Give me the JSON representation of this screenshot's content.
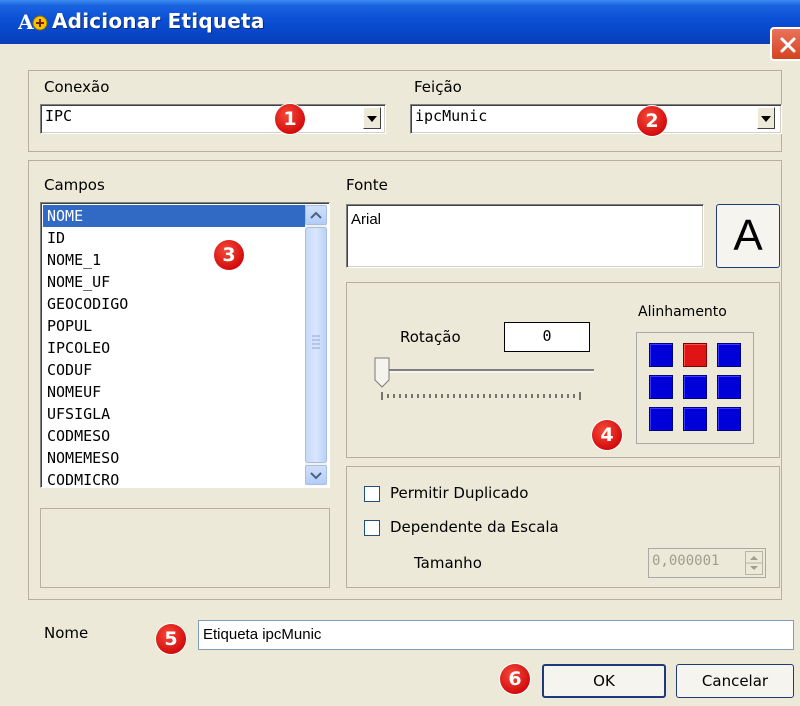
{
  "window": {
    "title": "Adicionar Etiqueta"
  },
  "conexao": {
    "label": "Conexão",
    "value": "IPC"
  },
  "feicao": {
    "label": "Feição",
    "value": "ipcMunic"
  },
  "campos": {
    "label": "Campos",
    "items": [
      "NOME",
      "ID",
      "NOME_1",
      "NOME_UF",
      "GEOCODIGO",
      "POPUL",
      "IPCOLEO",
      "CODUF",
      "NOMEUF",
      "UFSIGLA",
      "CODMESO",
      "NOMEMESO",
      "CODMICRO"
    ],
    "selected": "NOME"
  },
  "fonte": {
    "label": "Fonte",
    "value": "Arial",
    "button_label": "A"
  },
  "rotacao": {
    "label": "Rotação",
    "value": "0"
  },
  "alinhamento": {
    "label": "Alinhamento",
    "selected": "top-center"
  },
  "permitir_duplicado": {
    "label": "Permitir Duplicado",
    "checked": false
  },
  "dependente_escala": {
    "label": "Dependente da Escala",
    "checked": false
  },
  "tamanho": {
    "label": "Tamanho",
    "value": "0,000001"
  },
  "nome": {
    "label": "Nome",
    "value": "Etiqueta ipcMunic"
  },
  "buttons": {
    "ok": "OK",
    "cancel": "Cancelar"
  },
  "badges": [
    "1",
    "2",
    "3",
    "4",
    "5",
    "6"
  ],
  "colors": {
    "title_bar": "#0a4fd4",
    "selection": "#316ac5",
    "badge": "#d40d0d",
    "align_button": "#0000d8",
    "align_active": "#e01414"
  }
}
